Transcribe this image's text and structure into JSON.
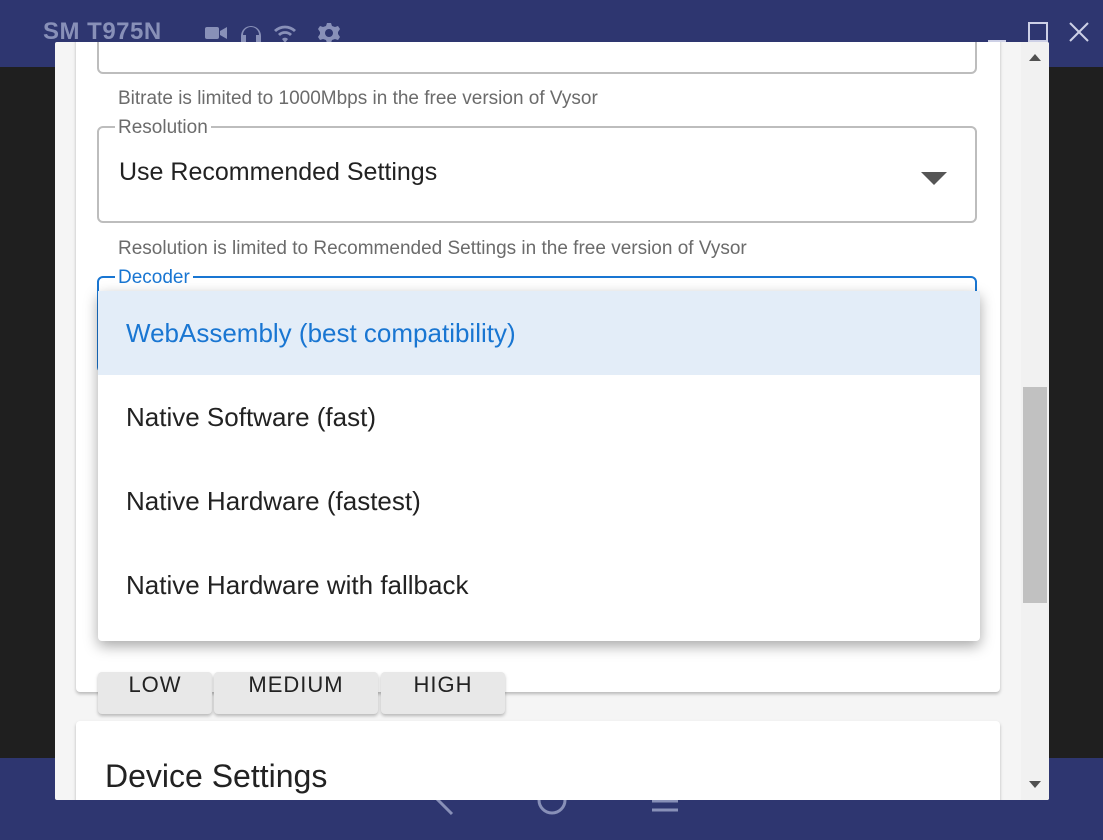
{
  "titlebar": {
    "device_name": "SM T975N",
    "icons": [
      "video-camera-icon",
      "headphones-icon",
      "wifi-icon",
      "gear-icon"
    ],
    "window_controls": [
      "minimize-icon",
      "maximize-icon",
      "close-icon"
    ]
  },
  "navbar": {
    "buttons": [
      "back-icon",
      "home-icon",
      "recents-icon"
    ]
  },
  "settings": {
    "bitrate_helper": "Bitrate is limited to 1000Mbps in the free version of Vysor",
    "resolution": {
      "label": "Resolution",
      "value": "Use Recommended Settings",
      "helper": "Resolution is limited to Recommended Settings in the free version of Vysor"
    },
    "decoder": {
      "label": "Decoder",
      "options": [
        "WebAssembly (best compatibility)",
        "Native Software (fast)",
        "Native Hardware (fastest)",
        "Native Hardware with fallback"
      ],
      "selected_index": 0
    },
    "quality_buttons": [
      "LOW",
      "MEDIUM",
      "HIGH"
    ]
  },
  "device_settings": {
    "title": "Device Settings"
  },
  "colors": {
    "titlebar_bg": "#2e3670",
    "accent": "#1976d2",
    "selected_bg": "#e3edf8"
  }
}
